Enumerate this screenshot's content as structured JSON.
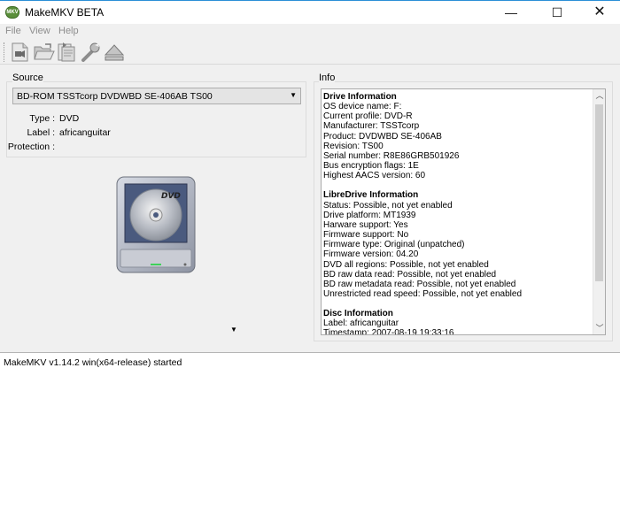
{
  "window": {
    "title": "MakeMKV BETA",
    "icon_text": "MKV",
    "minimize": "—",
    "maximize": "☐",
    "close": "✕"
  },
  "menu": [
    "File",
    "View",
    "Help"
  ],
  "toolbar_icons": [
    "open-files-icon",
    "open-folder-icon",
    "backup-icon",
    "preferences-wrench-icon",
    "eject-icon"
  ],
  "source": {
    "group_label": "Source",
    "drive_selected": "BD-ROM TSSTcorp DVDWBD SE-406AB TS00",
    "type_label": "Type :",
    "type_value": "DVD",
    "label_label": "Label :",
    "label_value": "africanguitar",
    "protection_label": "Protection :",
    "protection_value": ""
  },
  "disc_art_text": "DVD",
  "info": {
    "group_label": "Info",
    "lines": [
      {
        "text": "Drive Information",
        "heading": true
      },
      {
        "text": "OS device name: F:"
      },
      {
        "text": "Current profile: DVD-R"
      },
      {
        "text": "Manufacturer: TSSTcorp"
      },
      {
        "text": "Product: DVDWBD SE-406AB"
      },
      {
        "text": "Revision: TS00"
      },
      {
        "text": "Serial number: R8E86GRB501926"
      },
      {
        "text": "Bus encryption flags: 1E"
      },
      {
        "text": "Highest AACS version: 60"
      },
      {
        "text": ""
      },
      {
        "text": "LibreDrive Information",
        "heading": true
      },
      {
        "text": "Status: Possible, not yet enabled"
      },
      {
        "text": "Drive platform: MT1939"
      },
      {
        "text": "Harware support: Yes"
      },
      {
        "text": "Firmware support: No"
      },
      {
        "text": "Firmware type: Original (unpatched)"
      },
      {
        "text": "Firmware version: 04.20"
      },
      {
        "text": "DVD all regions: Possible, not yet enabled"
      },
      {
        "text": "BD raw data read: Possible, not yet enabled"
      },
      {
        "text": "BD raw metadata read: Possible, not yet enabled"
      },
      {
        "text": "Unrestricted read speed: Possible, not yet enabled"
      },
      {
        "text": ""
      },
      {
        "text": "Disc Information",
        "heading": true
      },
      {
        "text": "Label: africanguitar"
      },
      {
        "text": "Timestamp: 2007-08-19 19:33:16"
      }
    ]
  },
  "log": [
    "MakeMKV v1.14.2 win(x64-release) started"
  ]
}
